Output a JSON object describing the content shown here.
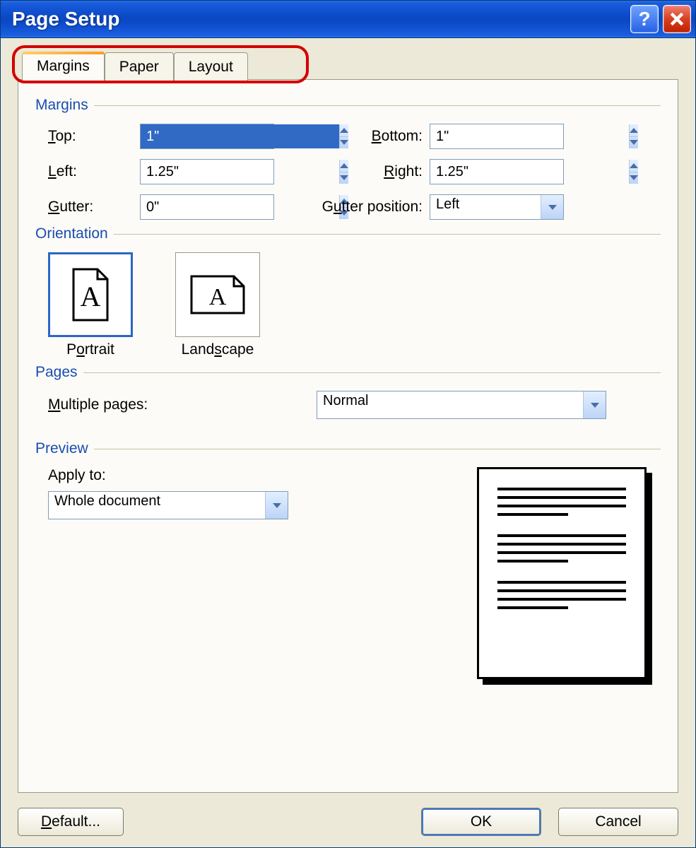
{
  "title": "Page Setup",
  "tabs": {
    "margins": "Margins",
    "paper": "Paper",
    "layout": "Layout"
  },
  "sections": {
    "margins": "Margins",
    "orientation": "Orientation",
    "pages": "Pages",
    "preview": "Preview"
  },
  "margins": {
    "top_label": "Top:",
    "top_u": "T",
    "bottom_label": "Bottom:",
    "bottom_u": "B",
    "left_label": "Left:",
    "left_u": "L",
    "right_label": "Right:",
    "right_u": "R",
    "gutter_label": "Gutter:",
    "gutter_u": "G",
    "gutterpos_label": "Gutter position:",
    "gutterpos_u": "u",
    "top_val": "1\"",
    "bottom_val": "1\"",
    "left_val": "1.25\"",
    "right_val": "1.25\"",
    "gutter_val": "0\"",
    "gutterpos_val": "Left"
  },
  "orientation": {
    "portrait": "Portrait",
    "landscape": "Landscape",
    "selected": "portrait"
  },
  "pages": {
    "multiple_label": "Multiple pages:",
    "multiple_val": "Normal"
  },
  "preview": {
    "applyto_label": "Apply to:",
    "applyto_val": "Whole document"
  },
  "buttons": {
    "default": "Default...",
    "ok": "OK",
    "cancel": "Cancel"
  }
}
